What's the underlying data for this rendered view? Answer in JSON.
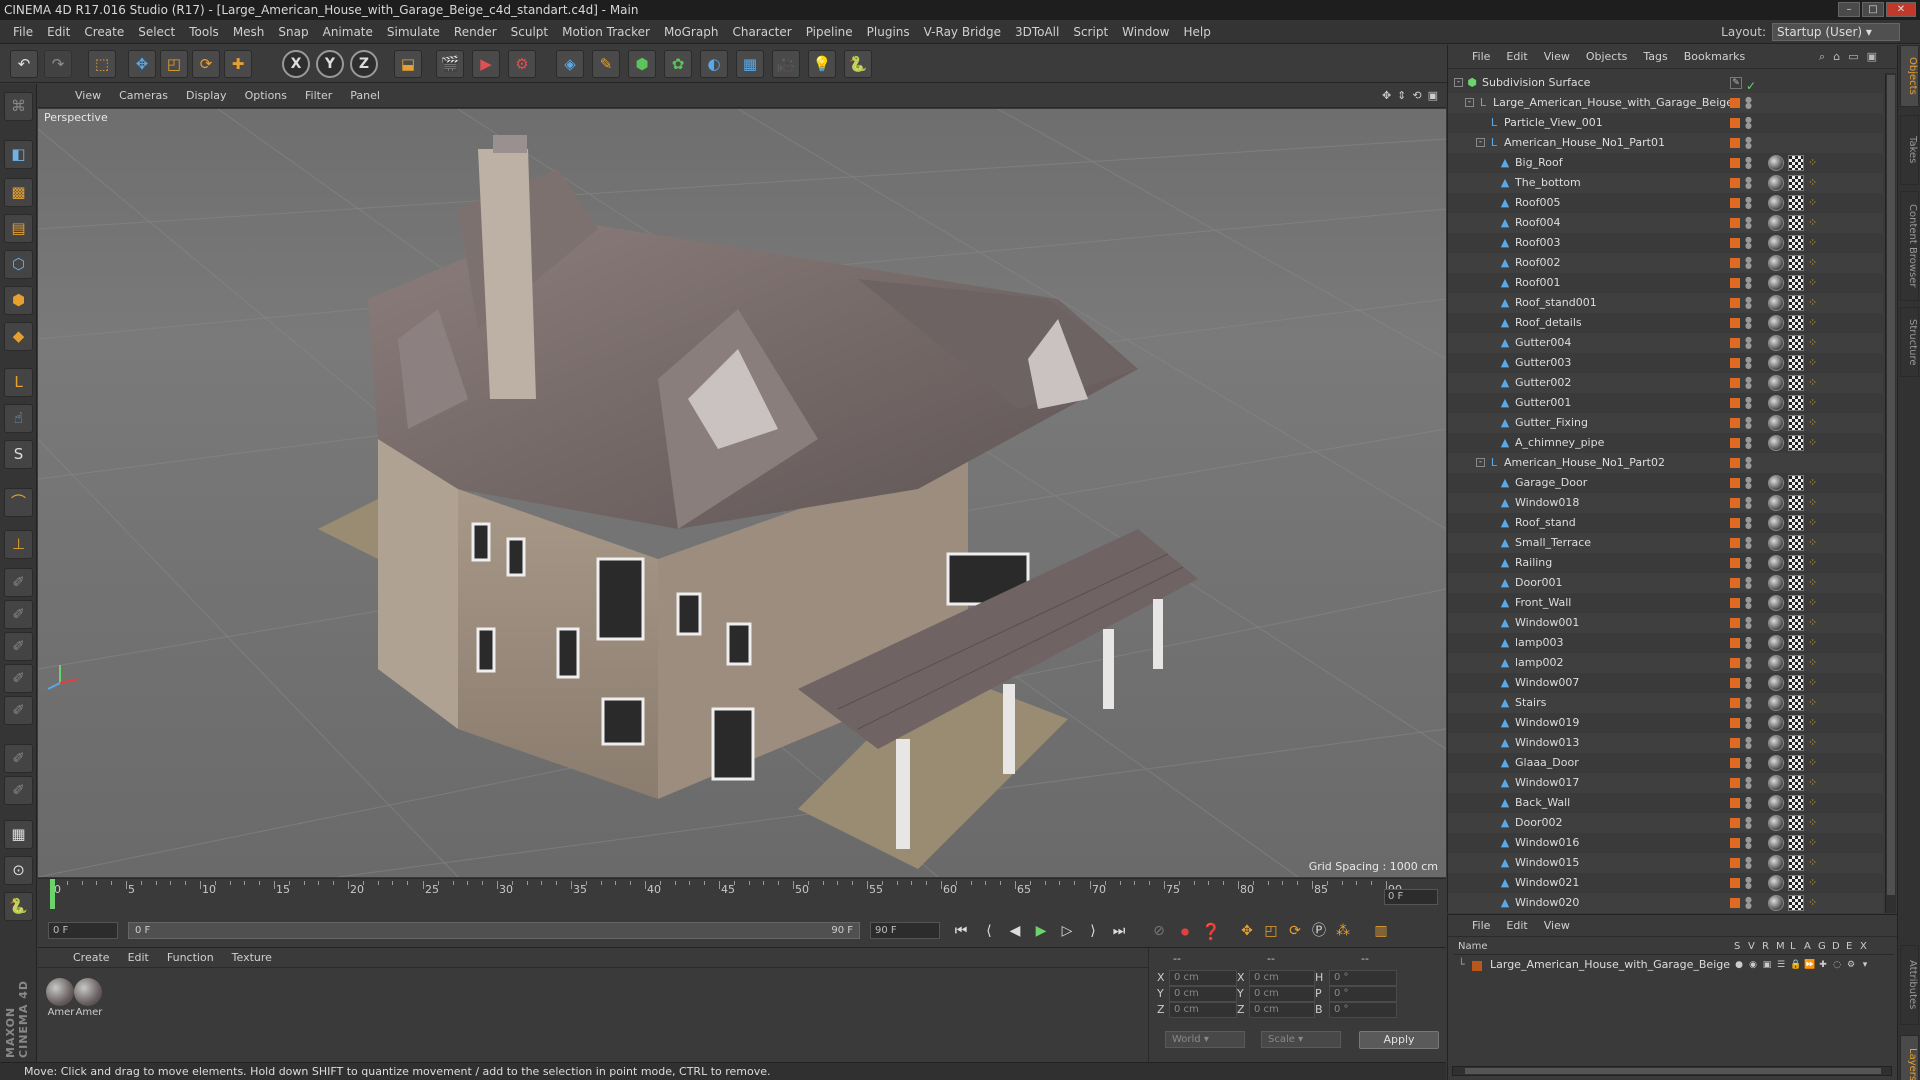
{
  "window": {
    "title": "CINEMA 4D R17.016 Studio (R17) - [Large_American_House_with_Garage_Beige_c4d_standart.c4d] - Main"
  },
  "menubar": {
    "items": [
      "File",
      "Edit",
      "Create",
      "Select",
      "Tools",
      "Mesh",
      "Snap",
      "Animate",
      "Simulate",
      "Render",
      "Sculpt",
      "Motion Tracker",
      "MoGraph",
      "Character",
      "Pipeline",
      "Plugins",
      "V-Ray Bridge",
      "3DToAll",
      "Script",
      "Window",
      "Help"
    ],
    "layout_label": "Layout:",
    "layout_value": "Startup (User)"
  },
  "toolbar": {
    "axis_x": "X",
    "axis_y": "Y",
    "axis_z": "Z"
  },
  "viewport": {
    "menu": [
      "View",
      "Cameras",
      "Display",
      "Options",
      "Filter",
      "Panel"
    ],
    "label": "Perspective",
    "grid_spacing": "Grid Spacing : 1000 cm"
  },
  "timeline": {
    "ticks": [
      "0",
      "5",
      "10",
      "15",
      "20",
      "25",
      "30",
      "35",
      "40",
      "45",
      "50",
      "55",
      "60",
      "65",
      "70",
      "75",
      "80",
      "85",
      "90"
    ],
    "current_frame_field": "0 F"
  },
  "transport": {
    "start_field": "0 F",
    "slider_start": "0 F",
    "slider_end": "90 F",
    "end_field": "90 F"
  },
  "materials": {
    "menu": [
      "Create",
      "Edit",
      "Function",
      "Texture"
    ],
    "items": [
      {
        "label": "Amer"
      },
      {
        "label": "Amer"
      }
    ]
  },
  "coords": {
    "col1_header": "--",
    "col2_header": "--",
    "col3_header": "--",
    "rows": [
      {
        "a": "X",
        "av": "0 cm",
        "b": "X",
        "bv": "0 cm",
        "c": "H",
        "cv": "0 °"
      },
      {
        "a": "Y",
        "av": "0 cm",
        "b": "Y",
        "bv": "0 cm",
        "c": "P",
        "cv": "0 °"
      },
      {
        "a": "Z",
        "av": "0 cm",
        "b": "Z",
        "bv": "0 cm",
        "c": "B",
        "cv": "0 °"
      }
    ],
    "space_dropdown": "World",
    "mode_dropdown": "Scale",
    "apply_label": "Apply"
  },
  "status": {
    "text": "Move: Click and drag to move elements. Hold down SHIFT to quantize movement / add to the selection in point mode, CTRL to remove."
  },
  "object_manager": {
    "menu": [
      "File",
      "Edit",
      "View",
      "Objects",
      "Tags",
      "Bookmarks"
    ],
    "objects": [
      {
        "name": "Subdivision Surface",
        "depth": 0,
        "expand": "-",
        "icon": "subdivision-icon",
        "tags": false
      },
      {
        "name": "Large_American_House_with_Garage_Beige",
        "depth": 1,
        "expand": "-",
        "icon": "null-icon",
        "tags": false
      },
      {
        "name": "Particle_View_001",
        "depth": 2,
        "expand": "",
        "icon": "null-icon",
        "tags": false
      },
      {
        "name": "American_House_No1_Part01",
        "depth": 2,
        "expand": "-",
        "icon": "null-icon",
        "tags": false
      },
      {
        "name": "Big_Roof",
        "depth": 3,
        "expand": "",
        "icon": "polygon-icon",
        "tags": true
      },
      {
        "name": "The_bottom",
        "depth": 3,
        "expand": "",
        "icon": "polygon-icon",
        "tags": true
      },
      {
        "name": "Roof005",
        "depth": 3,
        "expand": "",
        "icon": "polygon-icon",
        "tags": true
      },
      {
        "name": "Roof004",
        "depth": 3,
        "expand": "",
        "icon": "polygon-icon",
        "tags": true
      },
      {
        "name": "Roof003",
        "depth": 3,
        "expand": "",
        "icon": "polygon-icon",
        "tags": true
      },
      {
        "name": "Roof002",
        "depth": 3,
        "expand": "",
        "icon": "polygon-icon",
        "tags": true
      },
      {
        "name": "Roof001",
        "depth": 3,
        "expand": "",
        "icon": "polygon-icon",
        "tags": true
      },
      {
        "name": "Roof_stand001",
        "depth": 3,
        "expand": "",
        "icon": "polygon-icon",
        "tags": true
      },
      {
        "name": "Roof_details",
        "depth": 3,
        "expand": "",
        "icon": "polygon-icon",
        "tags": true
      },
      {
        "name": "Gutter004",
        "depth": 3,
        "expand": "",
        "icon": "polygon-icon",
        "tags": true
      },
      {
        "name": "Gutter003",
        "depth": 3,
        "expand": "",
        "icon": "polygon-icon",
        "tags": true
      },
      {
        "name": "Gutter002",
        "depth": 3,
        "expand": "",
        "icon": "polygon-icon",
        "tags": true
      },
      {
        "name": "Gutter001",
        "depth": 3,
        "expand": "",
        "icon": "polygon-icon",
        "tags": true
      },
      {
        "name": "Gutter_Fixing",
        "depth": 3,
        "expand": "",
        "icon": "polygon-icon",
        "tags": true
      },
      {
        "name": "A_chimney_pipe",
        "depth": 3,
        "expand": "",
        "icon": "polygon-icon",
        "tags": true
      },
      {
        "name": "American_House_No1_Part02",
        "depth": 2,
        "expand": "-",
        "icon": "null-icon",
        "tags": false
      },
      {
        "name": "Garage_Door",
        "depth": 3,
        "expand": "",
        "icon": "polygon-icon",
        "tags": true
      },
      {
        "name": "Window018",
        "depth": 3,
        "expand": "",
        "icon": "polygon-icon",
        "tags": true
      },
      {
        "name": "Roof_stand",
        "depth": 3,
        "expand": "",
        "icon": "polygon-icon",
        "tags": true
      },
      {
        "name": "Small_Terrace",
        "depth": 3,
        "expand": "",
        "icon": "polygon-icon",
        "tags": true
      },
      {
        "name": "Railing",
        "depth": 3,
        "expand": "",
        "icon": "polygon-icon",
        "tags": true
      },
      {
        "name": "Door001",
        "depth": 3,
        "expand": "",
        "icon": "polygon-icon",
        "tags": true
      },
      {
        "name": "Front_Wall",
        "depth": 3,
        "expand": "",
        "icon": "polygon-icon",
        "tags": true
      },
      {
        "name": "Window001",
        "depth": 3,
        "expand": "",
        "icon": "polygon-icon",
        "tags": true
      },
      {
        "name": "lamp003",
        "depth": 3,
        "expand": "",
        "icon": "polygon-icon",
        "tags": true
      },
      {
        "name": "lamp002",
        "depth": 3,
        "expand": "",
        "icon": "polygon-icon",
        "tags": true
      },
      {
        "name": "Window007",
        "depth": 3,
        "expand": "",
        "icon": "polygon-icon",
        "tags": true
      },
      {
        "name": "Stairs",
        "depth": 3,
        "expand": "",
        "icon": "polygon-icon",
        "tags": true
      },
      {
        "name": "Window019",
        "depth": 3,
        "expand": "",
        "icon": "polygon-icon",
        "tags": true
      },
      {
        "name": "Window013",
        "depth": 3,
        "expand": "",
        "icon": "polygon-icon",
        "tags": true
      },
      {
        "name": "Glaaa_Door",
        "depth": 3,
        "expand": "",
        "icon": "polygon-icon",
        "tags": true
      },
      {
        "name": "Window017",
        "depth": 3,
        "expand": "",
        "icon": "polygon-icon",
        "tags": true
      },
      {
        "name": "Back_Wall",
        "depth": 3,
        "expand": "",
        "icon": "polygon-icon",
        "tags": true
      },
      {
        "name": "Door002",
        "depth": 3,
        "expand": "",
        "icon": "polygon-icon",
        "tags": true
      },
      {
        "name": "Window016",
        "depth": 3,
        "expand": "",
        "icon": "polygon-icon",
        "tags": true
      },
      {
        "name": "Window015",
        "depth": 3,
        "expand": "",
        "icon": "polygon-icon",
        "tags": true
      },
      {
        "name": "Window021",
        "depth": 3,
        "expand": "",
        "icon": "polygon-icon",
        "tags": true
      },
      {
        "name": "Window020",
        "depth": 3,
        "expand": "",
        "icon": "polygon-icon",
        "tags": true
      }
    ]
  },
  "right_tabs": [
    "Objects",
    "Takes",
    "Content Browser",
    "Structure",
    "Attributes",
    "Layers"
  ],
  "layers": {
    "menu": [
      "File",
      "Edit",
      "View"
    ],
    "header_name": "Name",
    "header_flags": [
      "S",
      "V",
      "R",
      "M",
      "L",
      "A",
      "G",
      "D",
      "E",
      "X"
    ],
    "row_name": "Large_American_House_with_Garage_Beige"
  },
  "colors": {
    "accent_orange": "#e6a030",
    "layer_orange": "#e06a20",
    "playhead_green": "#6cd36c"
  }
}
